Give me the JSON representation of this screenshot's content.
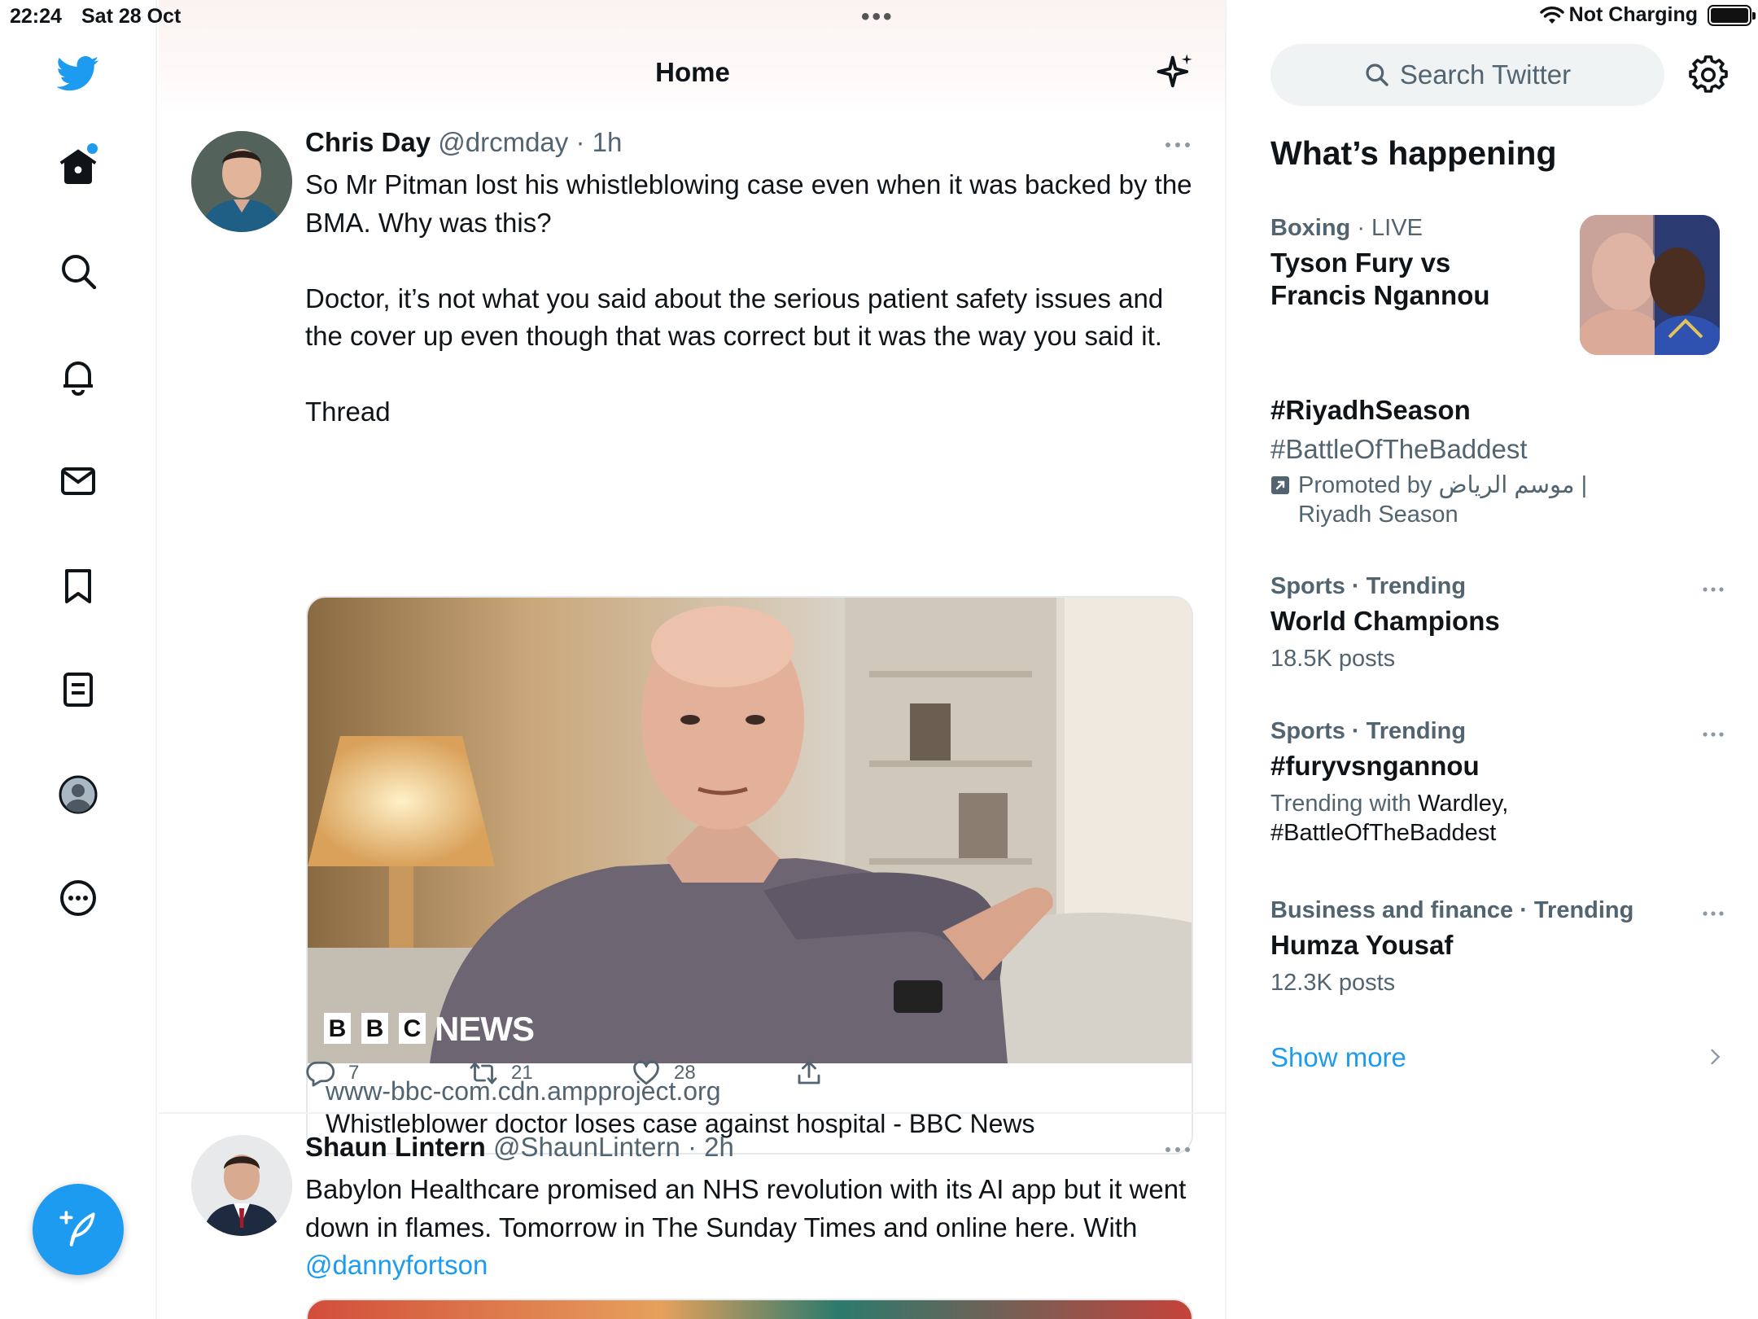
{
  "status_bar": {
    "time": "22:24",
    "date": "Sat 28 Oct",
    "multitask_dots": "•••",
    "charging": "Not Charging"
  },
  "nav": {
    "items": [
      "home",
      "explore",
      "notifications",
      "messages",
      "bookmarks",
      "lists",
      "profile",
      "more"
    ],
    "icons": [
      "twitter-bird-icon",
      "home-icon",
      "search-icon",
      "bell-icon",
      "mail-icon",
      "bookmark-icon",
      "list-icon",
      "avatar-icon",
      "more-circle-icon",
      "compose-icon"
    ]
  },
  "header": {
    "title": "Home"
  },
  "tweets": [
    {
      "name": "Chris Day",
      "handle": "@drcmday",
      "time": "· 1h",
      "text": "So Mr Pitman lost his whistleblowing case even when it was backed by the BMA. Why was this?\n\nDoctor, it’s not what you said about the serious patient safety issues and the cover up even though that was correct but it was the way you said it.\n\nThread",
      "card": {
        "image_logo_letters": [
          "B",
          "B",
          "C"
        ],
        "image_logo_word": "NEWS",
        "domain": "www-bbc-com.cdn.ampproject.org",
        "title": "Whistleblower doctor loses case against hospital - BBC News"
      },
      "replies": "7",
      "retweets": "21",
      "likes": "28"
    },
    {
      "name": "Shaun Lintern",
      "handle": "@ShaunLintern",
      "time": "· 2h",
      "text_before_mention": "Babylon Healthcare promised an NHS revolution with its AI app but it went down in flames. Tomorrow in The Sunday Times and online here. With ",
      "mention": "@dannyfortson"
    }
  ],
  "sidebar": {
    "search_placeholder": "Search Twitter",
    "section_title": "What’s happening",
    "trends": [
      {
        "category": "Boxing",
        "status": " · LIVE",
        "title": "Tyson Fury vs Francis Ngannou"
      },
      {
        "title": "#RiyadhSeason",
        "subtitle": "#BattleOfTheBaddest",
        "promoted": "Promoted by موسم الرياض | Riyadh Season"
      },
      {
        "category": "Sports · Trending",
        "title": "World Champions",
        "posts": "18.5K posts"
      },
      {
        "category": "Sports · Trending",
        "title": "#furyvsngannou",
        "trending_with_label": "Trending with ",
        "trending_with": "Wardley, #BattleOfTheBaddest"
      },
      {
        "category": "Business and finance · Trending",
        "title": "Humza Yousaf",
        "posts": "12.3K posts"
      }
    ],
    "show_more": "Show more"
  },
  "colors": {
    "accent": "#1d9bf0",
    "secondary_text": "#536471",
    "primary_text": "#0f1419",
    "divider": "#eff3f4"
  }
}
